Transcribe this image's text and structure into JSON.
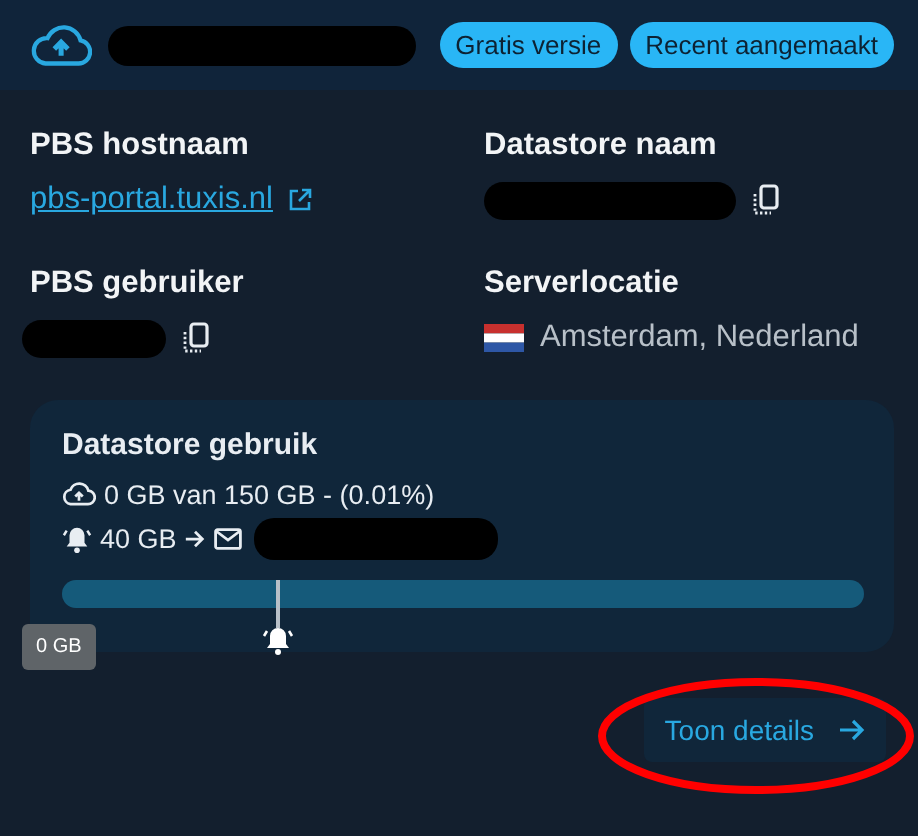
{
  "header": {
    "badges": [
      "Gratis versie",
      "Recent aangemaakt"
    ]
  },
  "fields": [
    {
      "label": "PBS hostnaam",
      "kind": "link",
      "value": "pbs-portal.tuxis.nl"
    },
    {
      "label": "Datastore naam",
      "kind": "redacted-copy"
    },
    {
      "label": "PBS gebruiker",
      "kind": "redacted-copy"
    },
    {
      "label": "Serverlocatie",
      "kind": "location",
      "value": "Amsterdam, Nederland"
    }
  ],
  "usage": {
    "title": "Datastore gebruik",
    "summary": "0 GB van 150 GB - (0.01%)",
    "level": 0.0001,
    "alert": {
      "amount": "40 GB",
      "level": 0.27
    },
    "tooltip": "0 GB"
  },
  "details_button": "Toon details"
}
